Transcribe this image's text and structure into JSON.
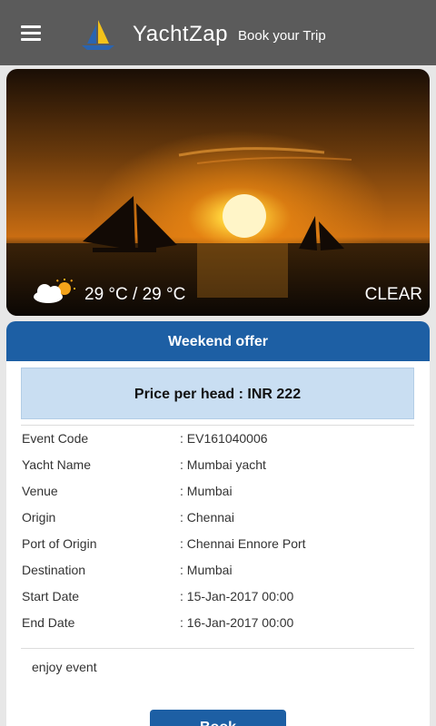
{
  "header": {
    "app_name": "YachtZap",
    "tagline": "Book your Trip"
  },
  "weather": {
    "temperature": "29 °C / 29 °C",
    "condition": "CLEAR",
    "icon": "partly-cloudy-icon"
  },
  "offer": {
    "title": "Weekend offer",
    "price": "Price per head : INR 222",
    "details": [
      {
        "label": "Event Code",
        "value": ": EV161040006"
      },
      {
        "label": "Yacht Name",
        "value": ": Mumbai yacht"
      },
      {
        "label": "Venue",
        "value": ": Mumbai"
      },
      {
        "label": "Origin",
        "value": ": Chennai"
      },
      {
        "label": "Port of Origin",
        "value": ": Chennai Ennore Port"
      },
      {
        "label": "Destination",
        "value": ": Mumbai"
      },
      {
        "label": "Start Date",
        "value": ": 15-Jan-2017 00:00"
      },
      {
        "label": "End Date",
        "value": ": 16-Jan-2017 00:00"
      }
    ],
    "description": "enjoy event",
    "book_label": "Book"
  },
  "colors": {
    "topbar": "#5b5b5b",
    "accent": "#1d5fa4",
    "price_bg": "#c9def2",
    "logo_sail": "#f3c21a"
  }
}
